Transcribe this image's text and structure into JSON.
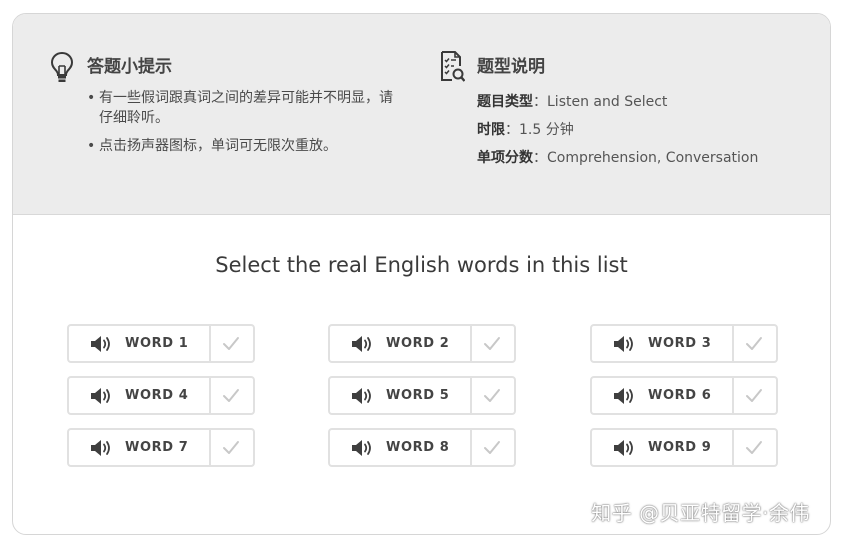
{
  "tips": {
    "title": "答题小提示",
    "items": [
      "有一些假词跟真词之间的差异可能并不明显，请仔细聆听。",
      "点击扬声器图标，单词可无限次重放。"
    ]
  },
  "type_info": {
    "title": "题型说明",
    "rows": [
      {
        "key": "题目类型",
        "sep": "：",
        "value": "Listen and Select"
      },
      {
        "key": "时限",
        "sep": "：",
        "value": "1.5 分钟"
      },
      {
        "key": "单项分数",
        "sep": "：",
        "value": "Comprehension, Conversation"
      }
    ]
  },
  "question": "Select the real English words in this list",
  "words": [
    {
      "label": "WORD 1"
    },
    {
      "label": "WORD 2"
    },
    {
      "label": "WORD 3"
    },
    {
      "label": "WORD 4"
    },
    {
      "label": "WORD 5"
    },
    {
      "label": "WORD 6"
    },
    {
      "label": "WORD 7"
    },
    {
      "label": "WORD 8"
    },
    {
      "label": "WORD 9"
    }
  ],
  "watermark": "知乎 @贝亚特留学·余伟",
  "colors": {
    "panel_bg": "#ececec",
    "border": "#e1e1e1",
    "check": "#c8c8c8",
    "text": "#444444"
  },
  "icons": {
    "tips": "lightbulb-icon",
    "type_info": "document-search-icon",
    "play": "speaker-icon",
    "select": "checkmark-icon"
  }
}
